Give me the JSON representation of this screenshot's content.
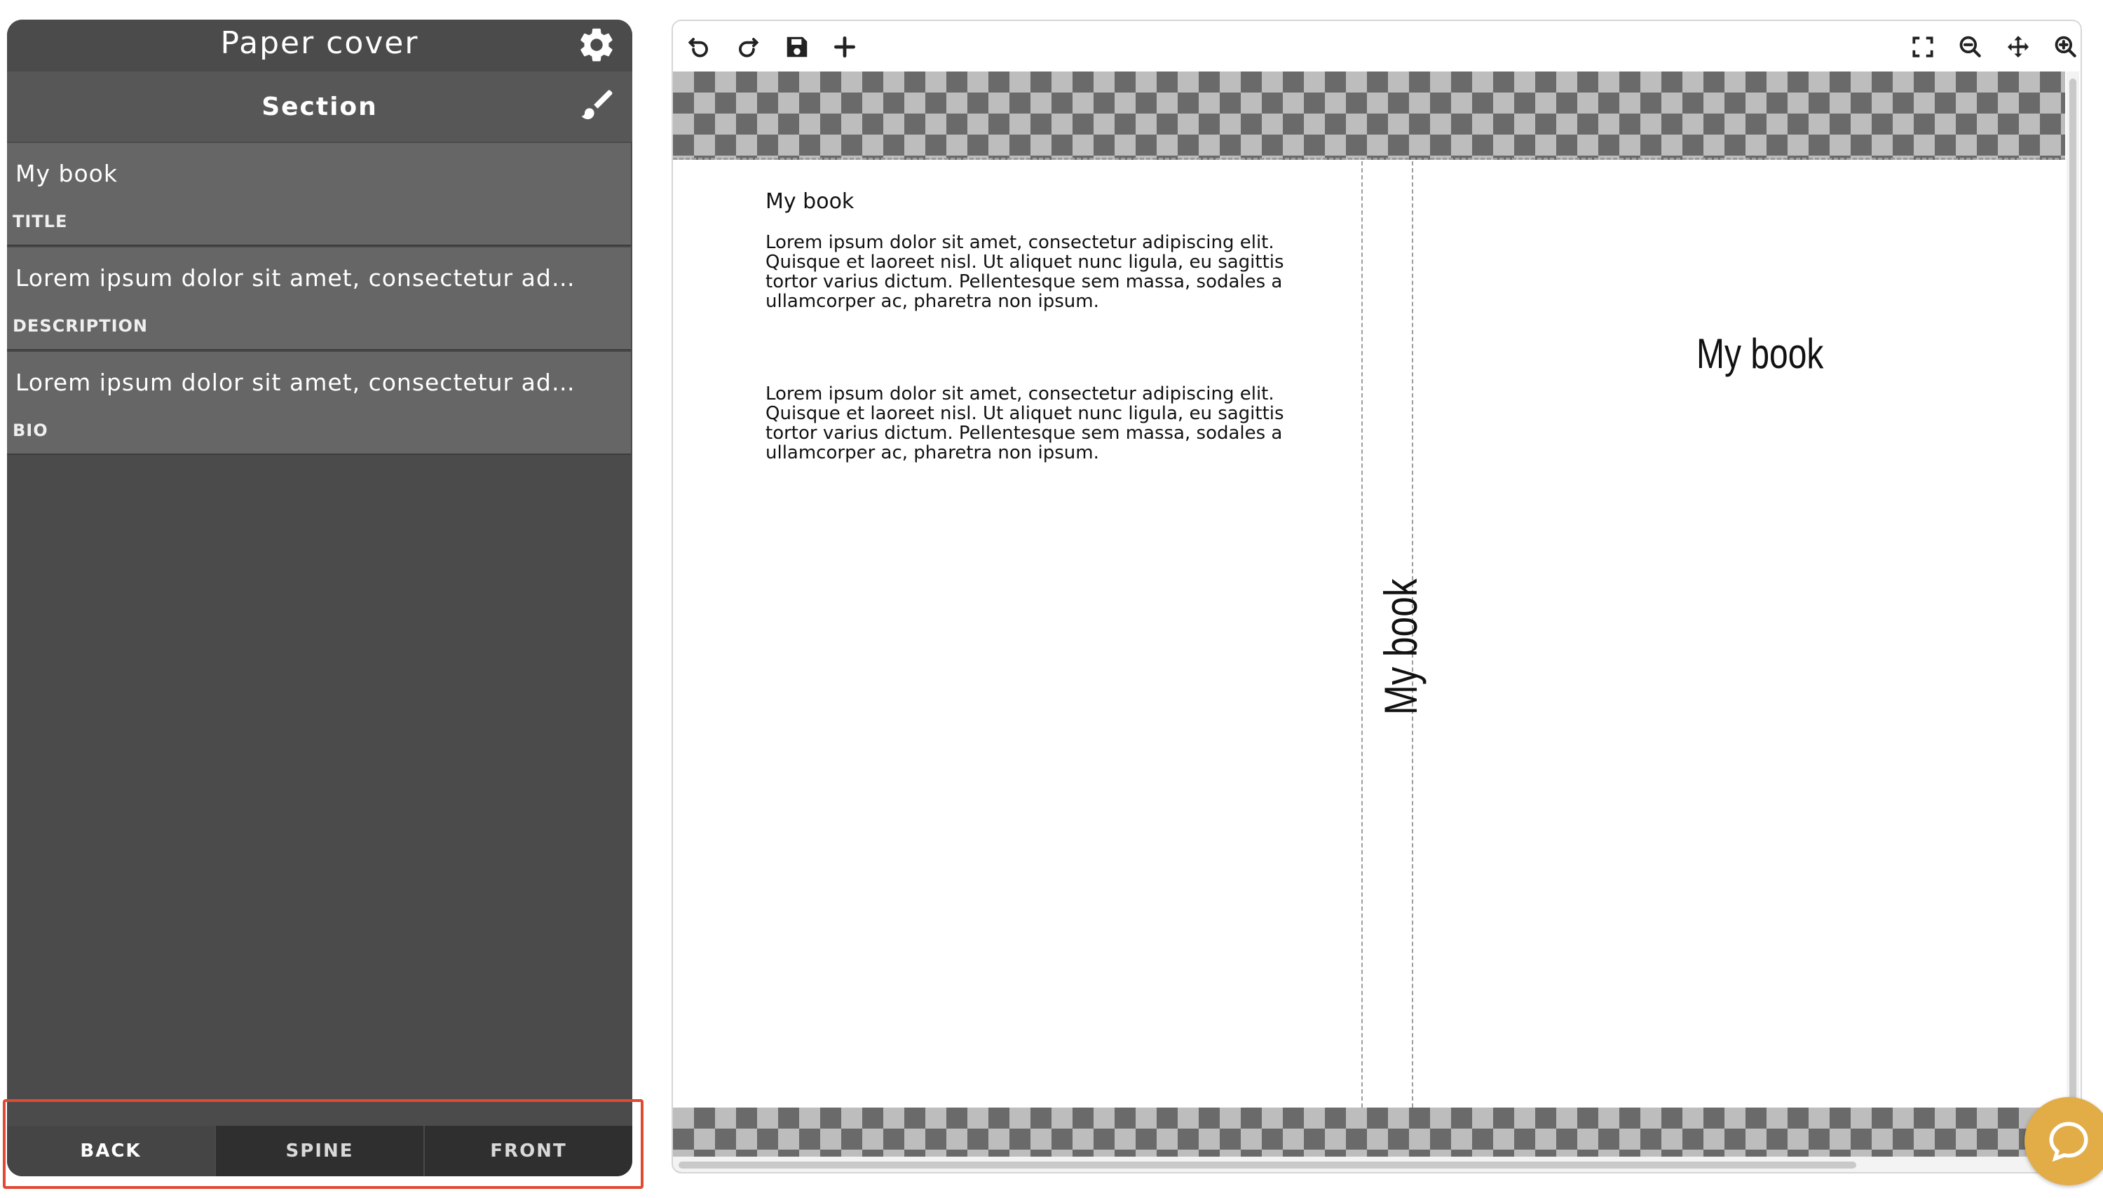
{
  "panel": {
    "title": "Paper cover",
    "section_title": "Section",
    "icons": {
      "settings": "gear-icon",
      "style": "brush-icon"
    },
    "fields": [
      {
        "value": "My book",
        "label": "TITLE"
      },
      {
        "value": "Lorem ipsum dolor sit amet, consectetur adipiscing elit. Quisque et laoreet nisl.",
        "label": "DESCRIPTION"
      },
      {
        "value": "Lorem ipsum dolor sit amet, consectetur adipiscing elit. Quisque et laoreet nisl.",
        "label": "BIO"
      }
    ],
    "tabs": [
      {
        "label": "BACK",
        "active": true
      },
      {
        "label": "SPINE",
        "active": false
      },
      {
        "label": "FRONT",
        "active": false
      }
    ],
    "highlight_color": "#e04a32"
  },
  "toolbar": {
    "left_icons": [
      "undo-icon",
      "redo-icon",
      "save-icon",
      "add-icon"
    ],
    "right_icons": [
      "fullscreen-icon",
      "zoom-out-icon",
      "move-icon",
      "zoom-in-icon"
    ]
  },
  "cover": {
    "back": {
      "title": "My book",
      "description": "Lorem ipsum dolor sit amet, consectetur adipiscing elit. Quisque et laoreet nisl. Ut aliquet nunc ligula, eu sagittis tortor varius dictum. Pellentesque sem massa, sodales a ullamcorper ac, pharetra non ipsum.",
      "bio": "Lorem ipsum dolor sit amet, consectetur adipiscing elit. Quisque et laoreet nisl. Ut aliquet nunc ligula, eu sagittis tortor varius dictum. Pellentesque sem massa, sodales a ullamcorper ac, pharetra non ipsum."
    },
    "spine": {
      "title": "My book"
    },
    "front": {
      "title": "My book"
    }
  },
  "chat": {
    "icon": "chat-bubble-icon",
    "color": "#e2ac47"
  }
}
